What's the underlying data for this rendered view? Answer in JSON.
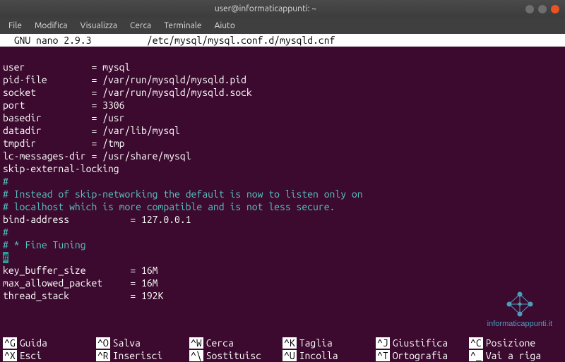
{
  "window": {
    "title": "user@informaticappunti: ~"
  },
  "menubar": {
    "items": [
      "File",
      "Modifica",
      "Visualizza",
      "Cerca",
      "Terminale",
      "Aiuto"
    ]
  },
  "nano": {
    "version": "GNU nano 2.9.3",
    "filepath": "/etc/mysql/mysql.conf.d/mysqld.cnf"
  },
  "config_lines": [
    {
      "t": "blank",
      "text": ""
    },
    {
      "t": "cfg",
      "text": "user            = mysql"
    },
    {
      "t": "cfg",
      "text": "pid-file        = /var/run/mysqld/mysqld.pid"
    },
    {
      "t": "cfg",
      "text": "socket          = /var/run/mysqld/mysqld.sock"
    },
    {
      "t": "cfg",
      "text": "port            = 3306"
    },
    {
      "t": "cfg",
      "text": "basedir         = /usr"
    },
    {
      "t": "cfg",
      "text": "datadir         = /var/lib/mysql"
    },
    {
      "t": "cfg",
      "text": "tmpdir          = /tmp"
    },
    {
      "t": "cfg",
      "text": "lc-messages-dir = /usr/share/mysql"
    },
    {
      "t": "cfg",
      "text": "skip-external-locking"
    },
    {
      "t": "com",
      "text": "#"
    },
    {
      "t": "com",
      "text": "# Instead of skip-networking the default is now to listen only on"
    },
    {
      "t": "com",
      "text": "# localhost which is more compatible and is not less secure."
    },
    {
      "t": "cfg",
      "text": "bind-address           = 127.0.0.1"
    },
    {
      "t": "com",
      "text": "#"
    },
    {
      "t": "com",
      "text": "# * Fine Tuning"
    },
    {
      "t": "cur",
      "text": "#"
    },
    {
      "t": "cfg",
      "text": "key_buffer_size        = 16M"
    },
    {
      "t": "cfg",
      "text": "max_allowed_packet     = 16M"
    },
    {
      "t": "cfg",
      "text": "thread_stack           = 192K"
    }
  ],
  "shortcuts": {
    "row1": [
      {
        "key": "^G",
        "desc": "Guida"
      },
      {
        "key": "^O",
        "desc": "Salva"
      },
      {
        "key": "^W",
        "desc": "Cerca"
      },
      {
        "key": "^K",
        "desc": "Taglia"
      },
      {
        "key": "^J",
        "desc": "Giustifica"
      },
      {
        "key": "^C",
        "desc": "Posizione"
      }
    ],
    "row2": [
      {
        "key": "^X",
        "desc": "Esci"
      },
      {
        "key": "^R",
        "desc": "Inserisci"
      },
      {
        "key": "^\\",
        "desc": "Sostituisc"
      },
      {
        "key": "^U",
        "desc": "Incolla"
      },
      {
        "key": "^T",
        "desc": "Ortografia"
      },
      {
        "key": "^_",
        "desc": "Vai a riga"
      }
    ]
  },
  "watermark": {
    "text": "informaticappunti.it"
  }
}
